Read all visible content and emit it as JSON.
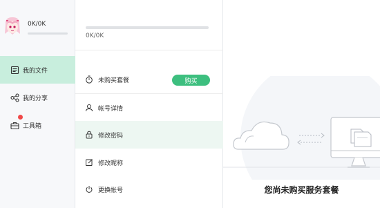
{
  "user": {
    "quota": "0K/0K"
  },
  "nav": [
    {
      "label": "我的文件",
      "icon": "file-icon",
      "active": true
    },
    {
      "label": "我的分享",
      "icon": "share-icon",
      "active": false
    },
    {
      "label": "工具箱",
      "icon": "toolbox-icon",
      "active": false,
      "notification": true
    }
  ],
  "storage": {
    "quota_text": "0K/0K",
    "used_fraction": 0
  },
  "menu": {
    "package": {
      "label": "未购买套餐",
      "icon": "stopwatch-icon",
      "button": "购买"
    },
    "items": [
      {
        "label": "帐号详情",
        "icon": "user-icon"
      },
      {
        "label": "修改密码",
        "icon": "lock-icon",
        "active": true
      },
      {
        "label": "修改昵称",
        "icon": "edit-icon"
      },
      {
        "label": "更换帐号",
        "icon": "power-icon"
      }
    ]
  },
  "empty_state": {
    "message": "您尚未购买服务套餐"
  },
  "colors": {
    "accent": "#3dbf7f",
    "active_nav_bg": "#c8eedd",
    "active_menu_bg": "#edf7f2",
    "notification": "#f04848"
  }
}
